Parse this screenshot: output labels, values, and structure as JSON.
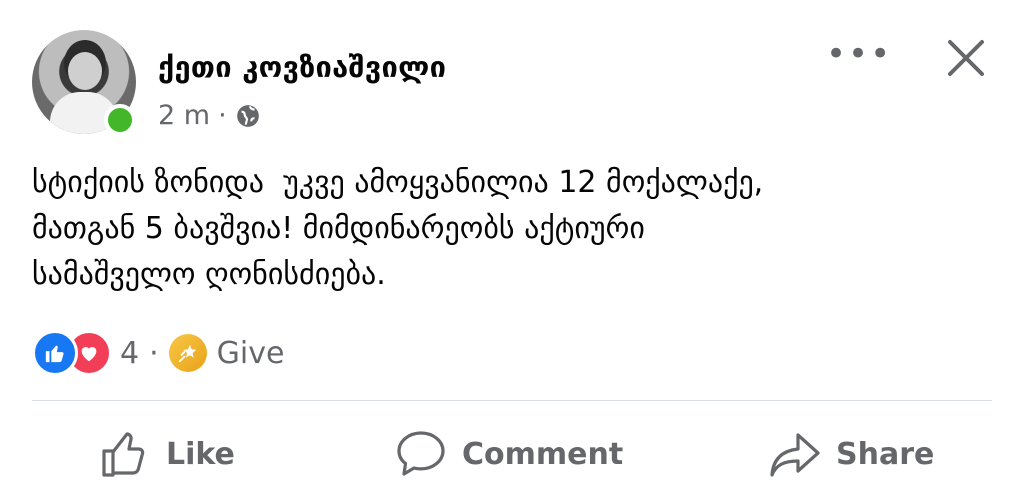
{
  "post": {
    "author": "ქეთი კოვზიაშვილი",
    "time": "2 m",
    "dot": "·",
    "privacy_icon": "globe-icon",
    "text": "სტიქიის ზონიდა  უკვე ამოყვანილია 12 მოქალაქე,\nმათგან 5 ბავშვია! მიმდინარეობს აქტიური\nსამაშველო ღონისძიება."
  },
  "header": {
    "more_icon": "more-icon",
    "more_label": "•••",
    "close_icon": "close-icon"
  },
  "reactions": {
    "count": "4",
    "dot": "·",
    "give_label": "Give",
    "like_color": "#1877f2",
    "love_color": "#f33e58"
  },
  "actions": {
    "like_label": "Like",
    "comment_label": "Comment",
    "share_label": "Share"
  },
  "colors": {
    "secondary_text": "#65676b",
    "online": "#42b72a"
  }
}
